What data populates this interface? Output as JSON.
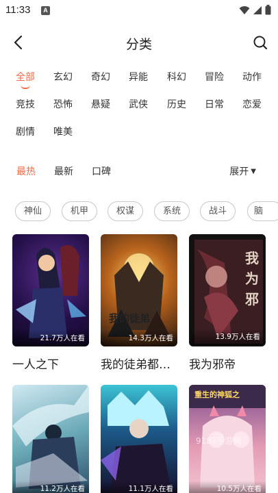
{
  "status_bar": {
    "time": "11:33",
    "notification_badge": "A"
  },
  "header": {
    "title": "分类"
  },
  "genres": {
    "active_index": 0,
    "rows": [
      [
        "全部",
        "玄幻",
        "奇幻",
        "异能",
        "科幻",
        "冒险",
        "动作"
      ],
      [
        "竞技",
        "恐怖",
        "悬疑",
        "武侠",
        "历史",
        "日常",
        "恋爱"
      ],
      [
        "剧情",
        "唯美"
      ]
    ]
  },
  "sort": {
    "options": [
      "最热",
      "最新",
      "口碑"
    ],
    "active_index": 0,
    "expand_label": "展开"
  },
  "tags": [
    "神仙",
    "机甲",
    "权谋",
    "系统",
    "战斗",
    "脑"
  ],
  "comics": [
    {
      "title": "一人之下",
      "views": "21.7万人在看"
    },
    {
      "title": "我的徒弟都…",
      "views": "14.3万人在看"
    },
    {
      "title": "我为邪帝",
      "views": "13.9万人在看"
    },
    {
      "title": "",
      "views": "11.2万人在看"
    },
    {
      "title": "",
      "views": "11.1万人在看"
    },
    {
      "title": "",
      "views": "10.5万人在看"
    }
  ],
  "watermark": "9187手游网",
  "colors": {
    "accent": "#f26b4a",
    "text": "#333333",
    "tag_border": "#c8c8c8"
  }
}
